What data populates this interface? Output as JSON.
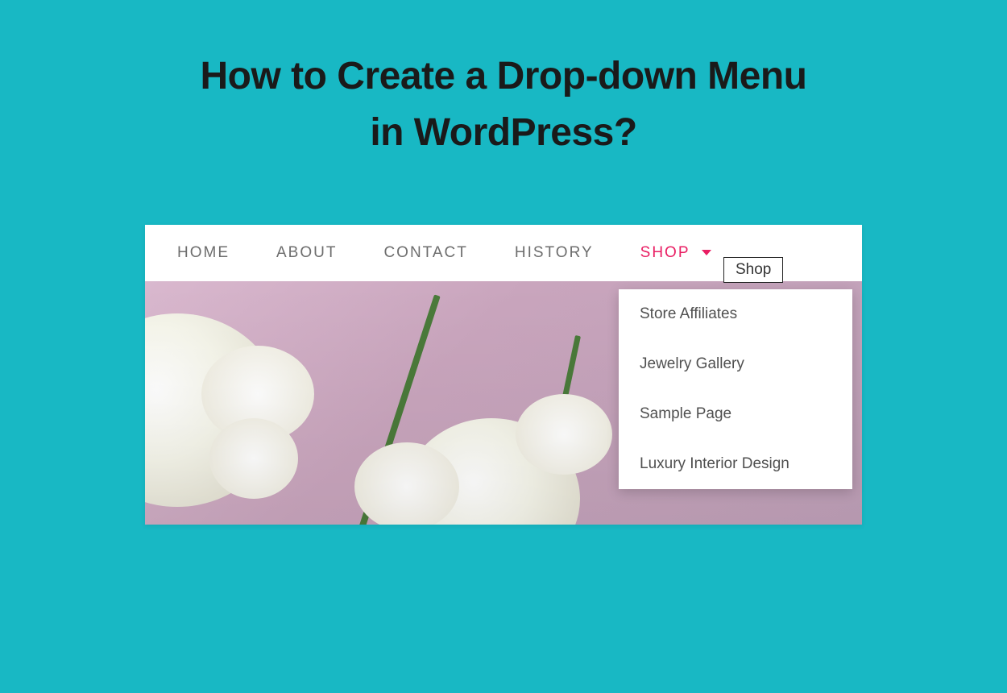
{
  "heading_line1": "How to Create a Drop-down Menu",
  "heading_line2": "in WordPress?",
  "nav": {
    "items": [
      {
        "label": "HOME"
      },
      {
        "label": "ABOUT"
      },
      {
        "label": "CONTACT"
      },
      {
        "label": "HISTORY"
      },
      {
        "label": "SHOP"
      }
    ]
  },
  "tooltip": "Shop",
  "dropdown": {
    "items": [
      {
        "label": "Store Affiliates"
      },
      {
        "label": "Jewelry Gallery"
      },
      {
        "label": "Sample Page"
      },
      {
        "label": "Luxury Interior Design"
      }
    ]
  }
}
